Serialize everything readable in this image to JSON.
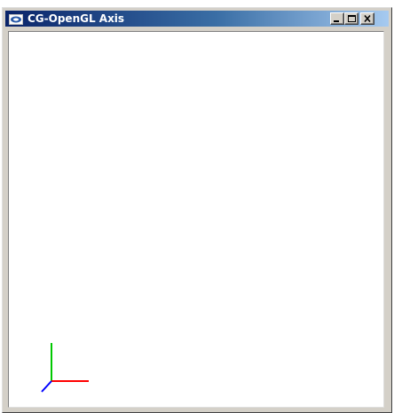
{
  "window": {
    "title": "CG-OpenGL Axis",
    "icon": "window-app-icon",
    "controls": [
      "minimize",
      "maximize",
      "close"
    ]
  },
  "scene": {
    "description_icons": [
      "x-axis-red",
      "y-axis-green",
      "z-axis-blue"
    ],
    "colors": {
      "x_axis": "#ff0000",
      "y_axis": "#00c800",
      "z_axis": "#0000ff",
      "background": "#ffffff"
    }
  }
}
